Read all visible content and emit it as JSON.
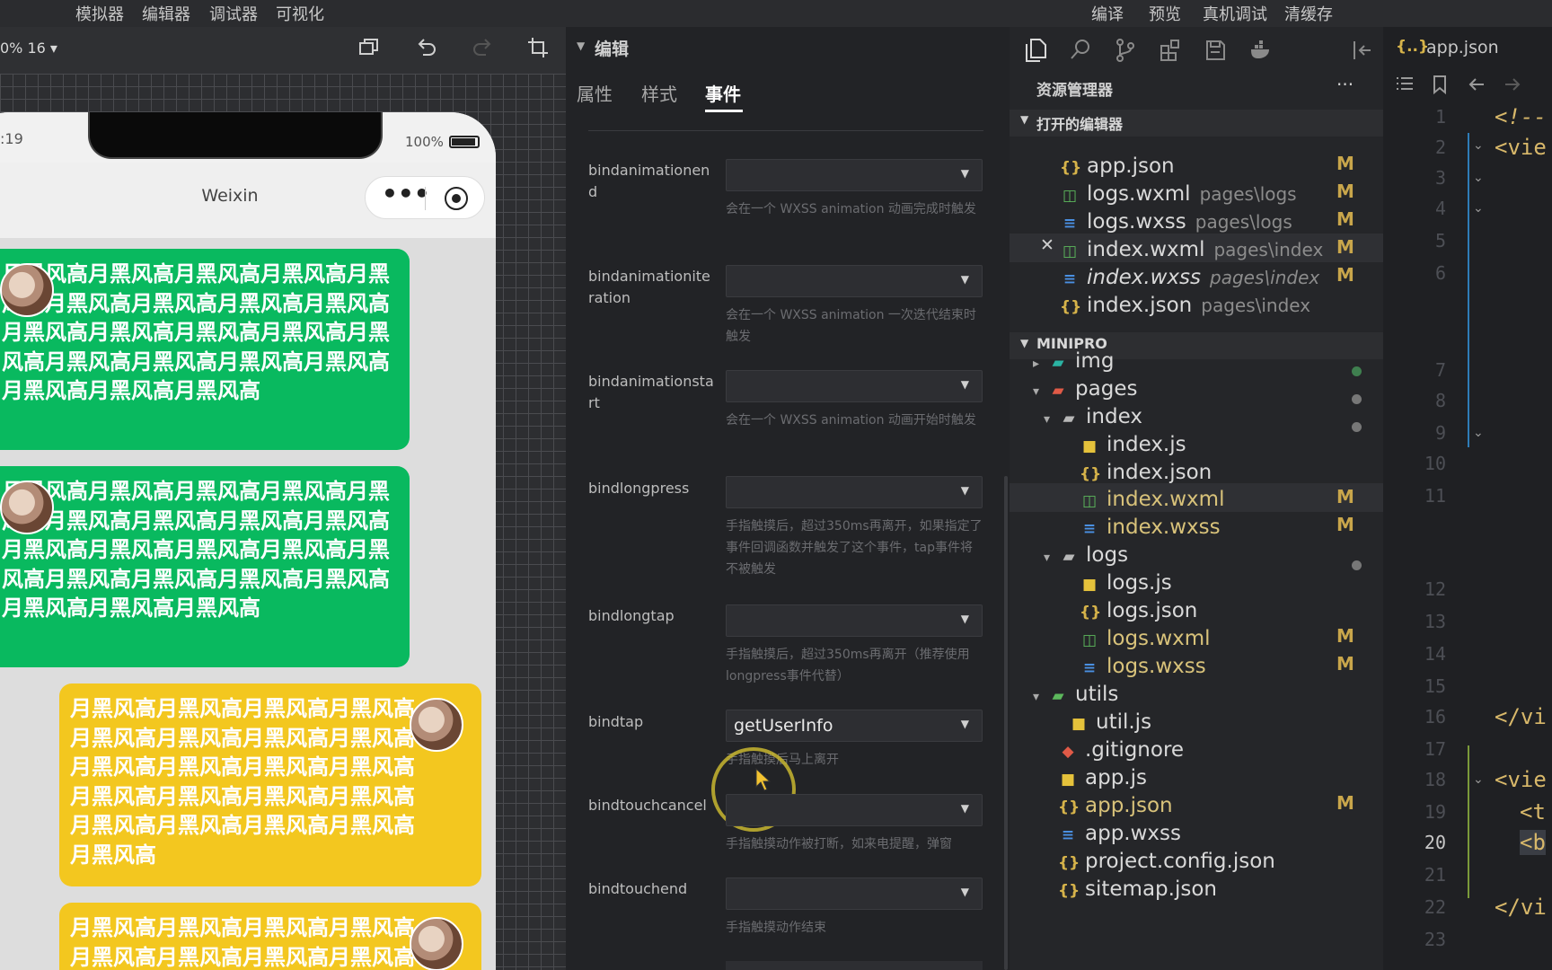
{
  "top_menu": {
    "left": [
      "模拟器",
      "编辑器",
      "调试器",
      "可视化"
    ],
    "right": [
      "编译",
      "预览",
      "真机调试",
      "清缓存"
    ]
  },
  "simulator": {
    "zoom_label": "0% 16 ▾",
    "status_time": ":19",
    "battery": "100%",
    "nav_title": "Weixin",
    "messages": [
      {
        "side": "left",
        "color": "green",
        "text": "月黑风高月黑风高月黑风高月黑风高月黑风高月黑风高月黑风高月黑风高月黑风高月黑风高月黑风高月黑风高月黑风高月黑风高月黑风高月黑风高月黑风高月黑风高月黑风高月黑风高月黑风高"
      },
      {
        "side": "left",
        "color": "green",
        "text": "月黑风高月黑风高月黑风高月黑风高月黑风高月黑风高月黑风高月黑风高月黑风高月黑风高月黑风高月黑风高月黑风高月黑风高月黑风高月黑风高月黑风高月黑风高月黑风高月黑风高月黑风高"
      },
      {
        "side": "right",
        "color": "yellow",
        "text": "月黑风高月黑风高月黑风高月黑风高月黑风高月黑风高月黑风高月黑风高月黑风高月黑风高月黑风高月黑风高月黑风高月黑风高月黑风高月黑风高月黑风高月黑风高月黑风高月黑风高月黑风高"
      },
      {
        "side": "right",
        "color": "yellow",
        "text": "月黑风高月黑风高月黑风高月黑风高月黑风高月黑风高月黑风高月黑风高"
      }
    ]
  },
  "inspector": {
    "header": "编辑",
    "tabs": [
      "属性",
      "样式",
      "事件"
    ],
    "active_tab": "事件",
    "events": [
      {
        "name": "bindanimationend",
        "value": "",
        "desc": "会在一个 WXSS animation 动画完成时触发"
      },
      {
        "name": "bindanimationiteration",
        "value": "",
        "desc": "会在一个 WXSS animation 一次迭代结束时触发"
      },
      {
        "name": "bindanimationstart",
        "value": "",
        "desc": "会在一个 WXSS animation 动画开始时触发"
      },
      {
        "name": "bindlongpress",
        "value": "",
        "desc": "手指触摸后，超过350ms再离开，如果指定了事件回调函数并触发了这个事件，tap事件将不被触发"
      },
      {
        "name": "bindlongtap",
        "value": "",
        "desc": "手指触摸后，超过350ms再离开（推荐使用longpress事件代替）"
      },
      {
        "name": "bindtap",
        "value": "getUserInfo",
        "desc": "手指触摸后马上离开"
      },
      {
        "name": "bindtouchcancel",
        "value": "",
        "desc": "手指触摸动作被打断，如来电提醒，弹窗"
      },
      {
        "name": "bindtouchend",
        "value": "",
        "desc": "手指触摸动作结束"
      }
    ]
  },
  "explorer": {
    "title": "资源管理器",
    "more": "···",
    "open_editors_title": "打开的编辑器",
    "open_editors": [
      {
        "icon": "json",
        "name": "app.json",
        "path": "",
        "status": "M"
      },
      {
        "icon": "wxml",
        "name": "logs.wxml",
        "path": "pages\\logs",
        "status": "M"
      },
      {
        "icon": "wxss",
        "name": "logs.wxss",
        "path": "pages\\logs",
        "status": "M"
      },
      {
        "icon": "wxml",
        "name": "index.wxml",
        "path": "pages\\index",
        "status": "M",
        "close": "✕"
      },
      {
        "icon": "wxss",
        "name": "index.wxss",
        "path": "pages\\index",
        "status": "M"
      },
      {
        "icon": "json",
        "name": "index.json",
        "path": "pages\\index",
        "status": ""
      }
    ],
    "project_title": "MINIPRO",
    "tree": [
      {
        "icon": "folder-img",
        "name": "img",
        "depth": 0,
        "arrow": "▸",
        "status": "dot"
      },
      {
        "icon": "folder-pages",
        "name": "pages",
        "depth": 0,
        "arrow": "▾",
        "status": "dot"
      },
      {
        "icon": "folder",
        "name": "index",
        "depth": 1,
        "arrow": "▾",
        "status": "dot"
      },
      {
        "icon": "js",
        "name": "index.js",
        "depth": 2,
        "arrow": "",
        "status": ""
      },
      {
        "icon": "json",
        "name": "index.json",
        "depth": 2,
        "arrow": "",
        "status": ""
      },
      {
        "icon": "wxml",
        "name": "index.wxml",
        "depth": 2,
        "arrow": "",
        "status": "M"
      },
      {
        "icon": "wxss",
        "name": "index.wxss",
        "depth": 2,
        "arrow": "",
        "status": "M"
      },
      {
        "icon": "folder",
        "name": "logs",
        "depth": 1,
        "arrow": "▾",
        "status": "dot"
      },
      {
        "icon": "js",
        "name": "logs.js",
        "depth": 2,
        "arrow": "",
        "status": ""
      },
      {
        "icon": "json",
        "name": "logs.json",
        "depth": 2,
        "arrow": "",
        "status": ""
      },
      {
        "icon": "wxml",
        "name": "logs.wxml",
        "depth": 2,
        "arrow": "",
        "status": "M"
      },
      {
        "icon": "wxss",
        "name": "logs.wxss",
        "depth": 2,
        "arrow": "",
        "status": "M"
      },
      {
        "icon": "folder-utils",
        "name": "utils",
        "depth": 0,
        "arrow": "▾",
        "status": ""
      },
      {
        "icon": "js",
        "name": "util.js",
        "depth": 1,
        "arrow": "",
        "status": ""
      },
      {
        "icon": "git",
        "name": ".gitignore",
        "depth": 0,
        "arrow": "",
        "status": ""
      },
      {
        "icon": "js",
        "name": "app.js",
        "depth": 0,
        "arrow": "",
        "status": ""
      },
      {
        "icon": "json",
        "name": "app.json",
        "depth": 0,
        "arrow": "",
        "status": "M"
      },
      {
        "icon": "wxss",
        "name": "app.wxss",
        "depth": 0,
        "arrow": "",
        "status": ""
      },
      {
        "icon": "json",
        "name": "project.config.json",
        "depth": 0,
        "arrow": "",
        "status": ""
      },
      {
        "icon": "json",
        "name": "sitemap.json",
        "depth": 0,
        "arrow": "",
        "status": ""
      }
    ]
  },
  "editor": {
    "tab_label": "app.json",
    "tab_icon": "{..}",
    "line_numbers": [
      "1",
      "2",
      "3",
      "4",
      "5",
      "6",
      "7",
      "8",
      "9",
      "10",
      "11",
      "12",
      "13",
      "14",
      "15",
      "16",
      "17",
      "18",
      "19",
      "20",
      "21",
      "22",
      "23"
    ],
    "current_line": "20",
    "code_fragments": [
      {
        "line": "1",
        "text": "<!--"
      },
      {
        "line": "2",
        "text": "<vie"
      },
      {
        "line": "16",
        "text": "</vi"
      },
      {
        "line": "18",
        "text": "<vie"
      },
      {
        "line": "19",
        "text": "<t"
      },
      {
        "line": "20",
        "text": "<b"
      },
      {
        "line": "22",
        "text": "</vi"
      }
    ]
  },
  "colors": {
    "accent_green": "#09b95f",
    "accent_yellow": "#f3c71f",
    "modified": "#c9a64b"
  }
}
